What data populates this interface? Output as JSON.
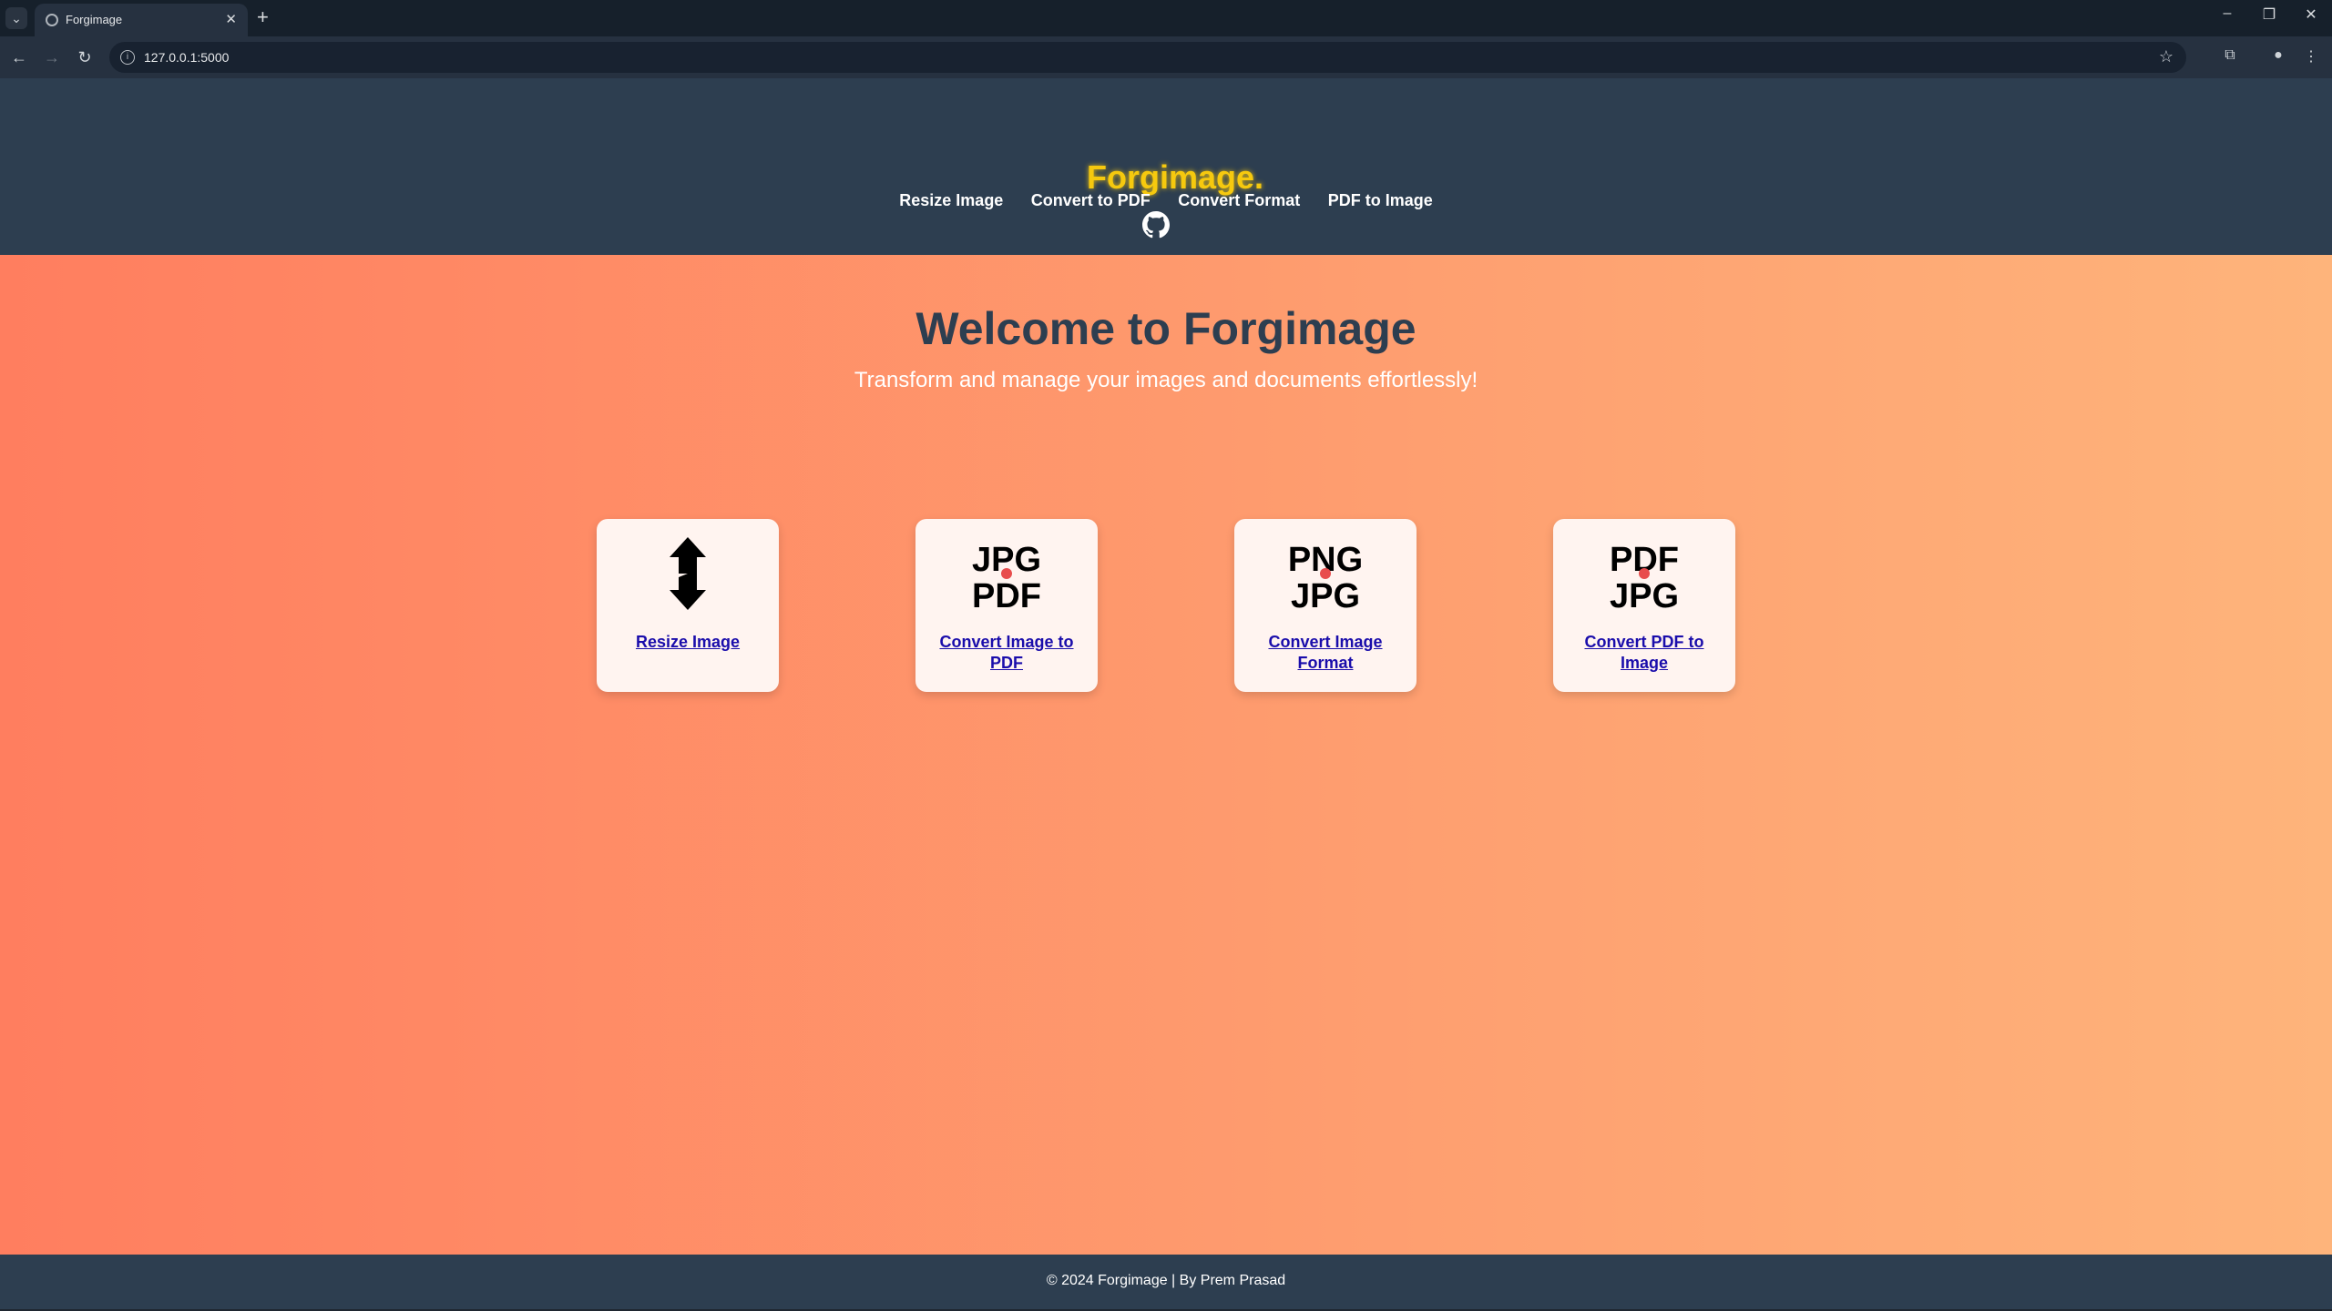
{
  "browser": {
    "tab_title": "Forgimage",
    "url": "127.0.0.1:5000"
  },
  "site": {
    "logo": "Forgimage.",
    "nav": [
      "Resize Image",
      "Convert to PDF",
      "Convert Format",
      "PDF to Image"
    ],
    "github_icon": "github-icon"
  },
  "hero": {
    "title": "Welcome to Forgimage",
    "subtitle": "Transform and manage your images and documents effortlessly!"
  },
  "cards": [
    {
      "label": "Resize Image",
      "icon": "resize-arrows-icon"
    },
    {
      "label": "Convert Image to PDF",
      "icon": "jpg-to-pdf-icon",
      "top": "JPG",
      "bottom": "PDF"
    },
    {
      "label": "Convert Image Format",
      "icon": "png-to-jpg-icon",
      "top": "PNG",
      "bottom": "JPG"
    },
    {
      "label": "Convert PDF to Image",
      "icon": "pdf-to-jpg-icon",
      "top": "PDF",
      "bottom": "JPG"
    }
  ],
  "footer": {
    "text": "© 2024 Forgimage | By Prem Prasad"
  },
  "colors": {
    "header_bg": "#2d3e50",
    "gradient_start": "#ff7e5f",
    "gradient_end": "#feb47b",
    "logo": "#f6c90e",
    "link": "#1a0dab"
  }
}
